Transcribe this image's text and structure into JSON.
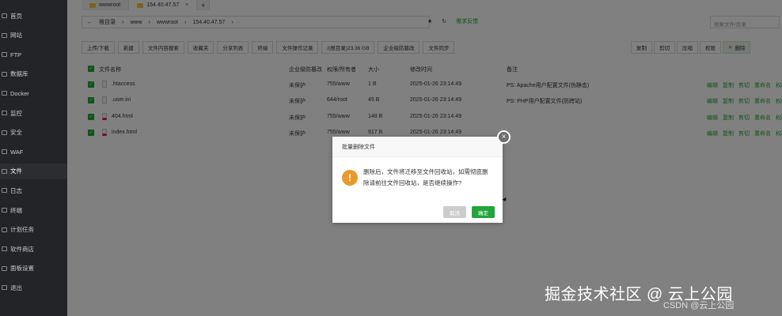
{
  "sidebar": {
    "items": [
      {
        "label": "首页"
      },
      {
        "label": "网站"
      },
      {
        "label": "FTP"
      },
      {
        "label": "数据库"
      },
      {
        "label": "Docker"
      },
      {
        "label": "监控"
      },
      {
        "label": "安全"
      },
      {
        "label": "WAF"
      },
      {
        "label": "文件",
        "active": true
      },
      {
        "label": "日志"
      },
      {
        "label": "终端"
      },
      {
        "label": "计划任务"
      },
      {
        "label": "软件商店"
      },
      {
        "label": "面板设置"
      },
      {
        "label": "退出"
      }
    ]
  },
  "tabs": [
    {
      "label": "wwwroot"
    },
    {
      "label": "154.40.47.57",
      "close": "×"
    },
    {
      "label": "+"
    }
  ],
  "breadcrumb": {
    "back": "←",
    "items": [
      "根目录",
      "www",
      "wwwroot",
      "154.40.47.57"
    ],
    "sep": "›"
  },
  "urlbar": {
    "star": "★",
    "refresh": "↻",
    "feedback": "需求反馈"
  },
  "search": {
    "placeholder": "搜索文件/目录"
  },
  "toolbar": {
    "left": [
      "上传/下载",
      "新建",
      "文件内容搜索",
      "收藏夹",
      "分享列表",
      "终端",
      "文件操作记录",
      "/(根目录)23.36 GB",
      "企业级防篡改",
      "文件同步"
    ],
    "right": [
      "复制",
      "剪切",
      "压缩",
      "权限",
      "删除"
    ]
  },
  "table": {
    "headers": [
      "文件名称",
      "企业级防篡改",
      "权限/所有者",
      "大小",
      "修改时间",
      "备注"
    ],
    "rows": [
      {
        "name": ".htaccess",
        "protect": "未保护",
        "perm": "755/www",
        "size": "1 B",
        "mtime": "2025-01-26 23:14:49",
        "note": "PS: Apache用户配置文件(伪静态)",
        "type": "file"
      },
      {
        "name": ".user.ini",
        "protect": "未保护",
        "perm": "644/root",
        "size": "45 B",
        "mtime": "2025-01-26 23:14:49",
        "note": "PS: PHP用户配置文件(防跨站)",
        "type": "file"
      },
      {
        "name": "404.html",
        "protect": "未保护",
        "perm": "755/www",
        "size": "148 B",
        "mtime": "2025-01-26 23:14:49",
        "note": "",
        "type": "html"
      },
      {
        "name": "index.html",
        "protect": "未保护",
        "perm": "755/www",
        "size": "917 B",
        "mtime": "2025-01-26 23:14:49",
        "note": "",
        "type": "html"
      }
    ],
    "actions": [
      "编辑",
      "复制",
      "剪切",
      "重命名",
      "权限"
    ]
  },
  "dialog": {
    "title": "批量删除文件",
    "message": "删除后，文件将迁移至文件回收站，如需彻底删除请前往文件回收站，是否继续操作?",
    "cancel": "取消",
    "confirm": "确定",
    "icon": "!"
  },
  "watermark": {
    "main": "掘金技术社区 @ 云上公园",
    "sub": "CSDN @云上公园"
  },
  "colors": {
    "accent": "#20a53a",
    "sidebar": "#232428",
    "warning": "#e89a2c"
  }
}
